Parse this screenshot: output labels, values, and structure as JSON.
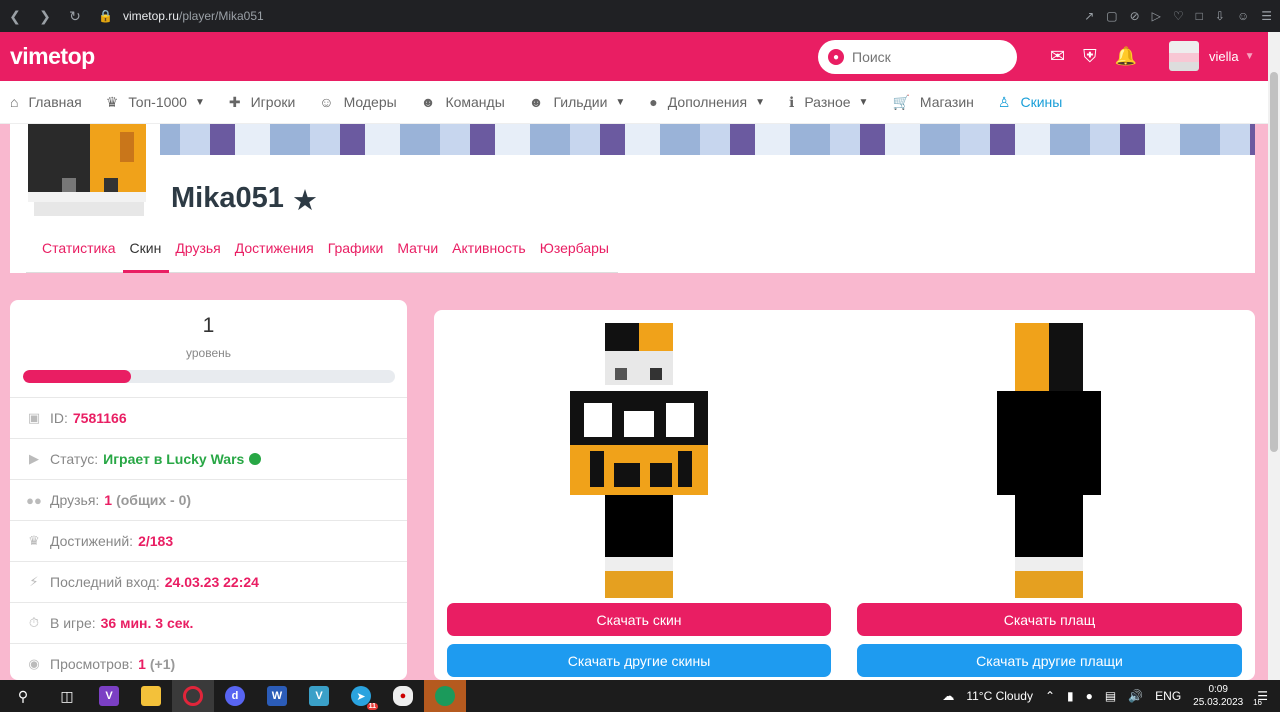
{
  "browser": {
    "url_domain": "vimetop.ru",
    "url_path": "/player/Mika051"
  },
  "header": {
    "logo": "vimetop",
    "search_placeholder": "Поиск",
    "username": "viella"
  },
  "menu": {
    "items": [
      {
        "label": "Главная",
        "icon": "home-icon",
        "dropdown": false
      },
      {
        "label": "Топ-1000",
        "icon": "trophy-icon",
        "dropdown": true
      },
      {
        "label": "Игроки",
        "icon": "user-plus-icon",
        "dropdown": false
      },
      {
        "label": "Модеры",
        "icon": "moderator-icon",
        "dropdown": false
      },
      {
        "label": "Команды",
        "icon": "users-icon",
        "dropdown": false
      },
      {
        "label": "Гильдии",
        "icon": "guild-icon",
        "dropdown": true
      },
      {
        "label": "Дополнения",
        "icon": "drop-icon",
        "dropdown": true
      },
      {
        "label": "Разное",
        "icon": "info-icon",
        "dropdown": true
      },
      {
        "label": "Магазин",
        "icon": "cart-icon",
        "dropdown": false
      },
      {
        "label": "Скины",
        "icon": "shirt-icon",
        "dropdown": false,
        "active": true
      }
    ]
  },
  "profile": {
    "nickname": "Mika051",
    "tabs": [
      "Статистика",
      "Скин",
      "Друзья",
      "Достижения",
      "Графики",
      "Матчи",
      "Активность",
      "Юзербары"
    ],
    "active_tab": "Скин"
  },
  "stats": {
    "level": "1",
    "level_label": "уровень",
    "level_progress_percent": 29,
    "id_label": "ID:",
    "id_value": "7581166",
    "status_label": "Статус:",
    "status_value": "Играет в Lucky Wars",
    "friends_label": "Друзья:",
    "friends_value": "1",
    "friends_common": "(общих - 0)",
    "achievements_label": "Достижений:",
    "achievements_value": "2/183",
    "last_login_label": "Последний вход:",
    "last_login_value": "24.03.23 22:24",
    "ingame_label": "В игре:",
    "ingame_value": "36 мин. 3 сек.",
    "views_label": "Просмотров:",
    "views_value": "1",
    "views_extra": "(+1)"
  },
  "skin": {
    "download_skin": "Скачать скин",
    "download_other_skins": "Скачать другие скины",
    "download_cape": "Скачать плащ",
    "download_other_capes": "Скачать другие плащи"
  },
  "taskbar": {
    "weather": "11°C  Cloudy",
    "lang": "ENG",
    "time": "0:09",
    "date": "25.03.2023",
    "notifications": "16",
    "telegram_badge": "11"
  },
  "colors": {
    "brand": "#e91e63",
    "accent_blue": "#1e9bf0",
    "page_bg": "#f9b8cf",
    "status_green": "#28a745"
  }
}
